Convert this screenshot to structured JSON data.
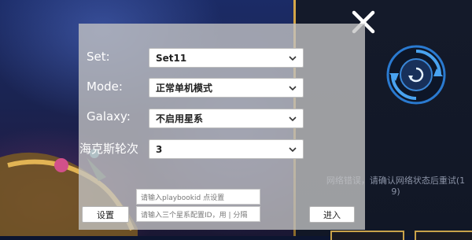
{
  "dialog": {
    "set": {
      "label": "Set:",
      "value": "Set11"
    },
    "mode": {
      "label": "Mode:",
      "value": "正常单机模式"
    },
    "galaxy": {
      "label": "Galaxy:",
      "value": "不启用星系"
    },
    "hex_rounds": {
      "label": "海克斯轮次",
      "value": "3"
    },
    "playbook_input": {
      "placeholder": "请输入playbookid 点设置"
    },
    "galaxy_ids_input": {
      "placeholder": "请输入三个星系配置ID，用 | 分隔"
    },
    "settings_button": "设置",
    "enter_button": "进入"
  },
  "status": {
    "network_error": "网络错误，请确认网络状态后重试(1",
    "error_code_tail": "9)"
  },
  "icons": {
    "close": "close-icon",
    "chevron": "chevron-down-icon",
    "loading": "refresh-icon"
  },
  "colors": {
    "dialog_overlay": "#c4c4c4",
    "gold_trim": "#c9a24a",
    "loading_ring": "#3a86d6"
  }
}
